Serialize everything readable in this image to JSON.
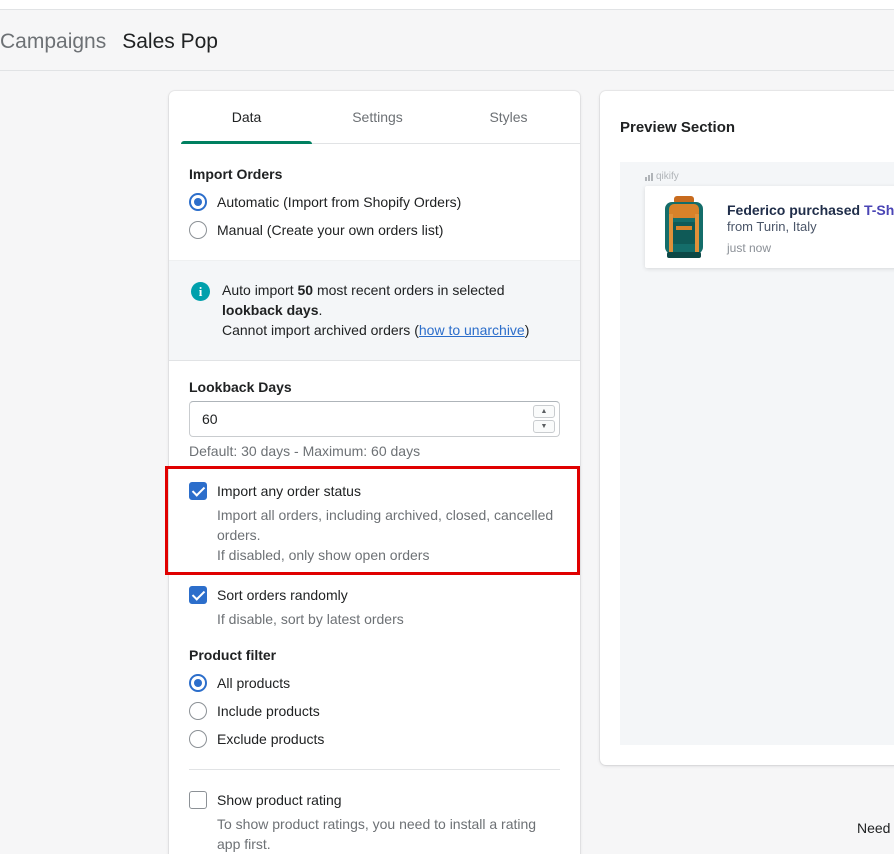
{
  "breadcrumb": {
    "parent": "Campaigns",
    "current": "Sales Pop"
  },
  "tabs": [
    {
      "label": "Data",
      "active": true
    },
    {
      "label": "Settings",
      "active": false
    },
    {
      "label": "Styles",
      "active": false
    }
  ],
  "import_orders": {
    "title": "Import Orders",
    "options": [
      {
        "label": "Automatic (Import from Shopify Orders)",
        "checked": true
      },
      {
        "label": "Manual (Create your own orders list)",
        "checked": false
      }
    ]
  },
  "info_banner": {
    "icon": "info-icon",
    "prefix": "Auto import ",
    "count": "50",
    "middle": " most recent orders in selected ",
    "bold_term": "lookback days",
    "suffix": ".",
    "line2_prefix": "Cannot import archived orders (",
    "link": "how to unarchive",
    "line2_suffix": ")"
  },
  "lookback": {
    "label": "Lookback Days",
    "value": "60",
    "help": "Default: 30 days - Maximum: 60 days"
  },
  "import_any_status": {
    "label": "Import any order status",
    "checked": true,
    "help_line1": "Import all orders, including archived, closed, cancelled",
    "help_line2": "orders.",
    "help_line3": "If disabled, only show open orders"
  },
  "sort_random": {
    "label": "Sort orders randomly",
    "checked": true,
    "help": "If disable, sort by latest orders"
  },
  "product_filter": {
    "title": "Product filter",
    "options": [
      {
        "label": "All products",
        "checked": true
      },
      {
        "label": "Include products",
        "checked": false
      },
      {
        "label": "Exclude products",
        "checked": false
      }
    ]
  },
  "product_rating": {
    "label": "Show product rating",
    "checked": false,
    "help_line1": "To show product ratings, you need to install a rating",
    "help_line2": "app first."
  },
  "preview": {
    "title": "Preview Section",
    "brand": "qikify",
    "popup": {
      "buyer": "Federico purchased",
      "product": "T-Sh",
      "location": "from Turin, Italy",
      "time": "just now"
    }
  },
  "footer_text": "Need",
  "colors": {
    "accent_tab": "#008060",
    "checkbox": "#2c6ecb",
    "highlight": "#e00000",
    "info": "#00a0ac"
  }
}
